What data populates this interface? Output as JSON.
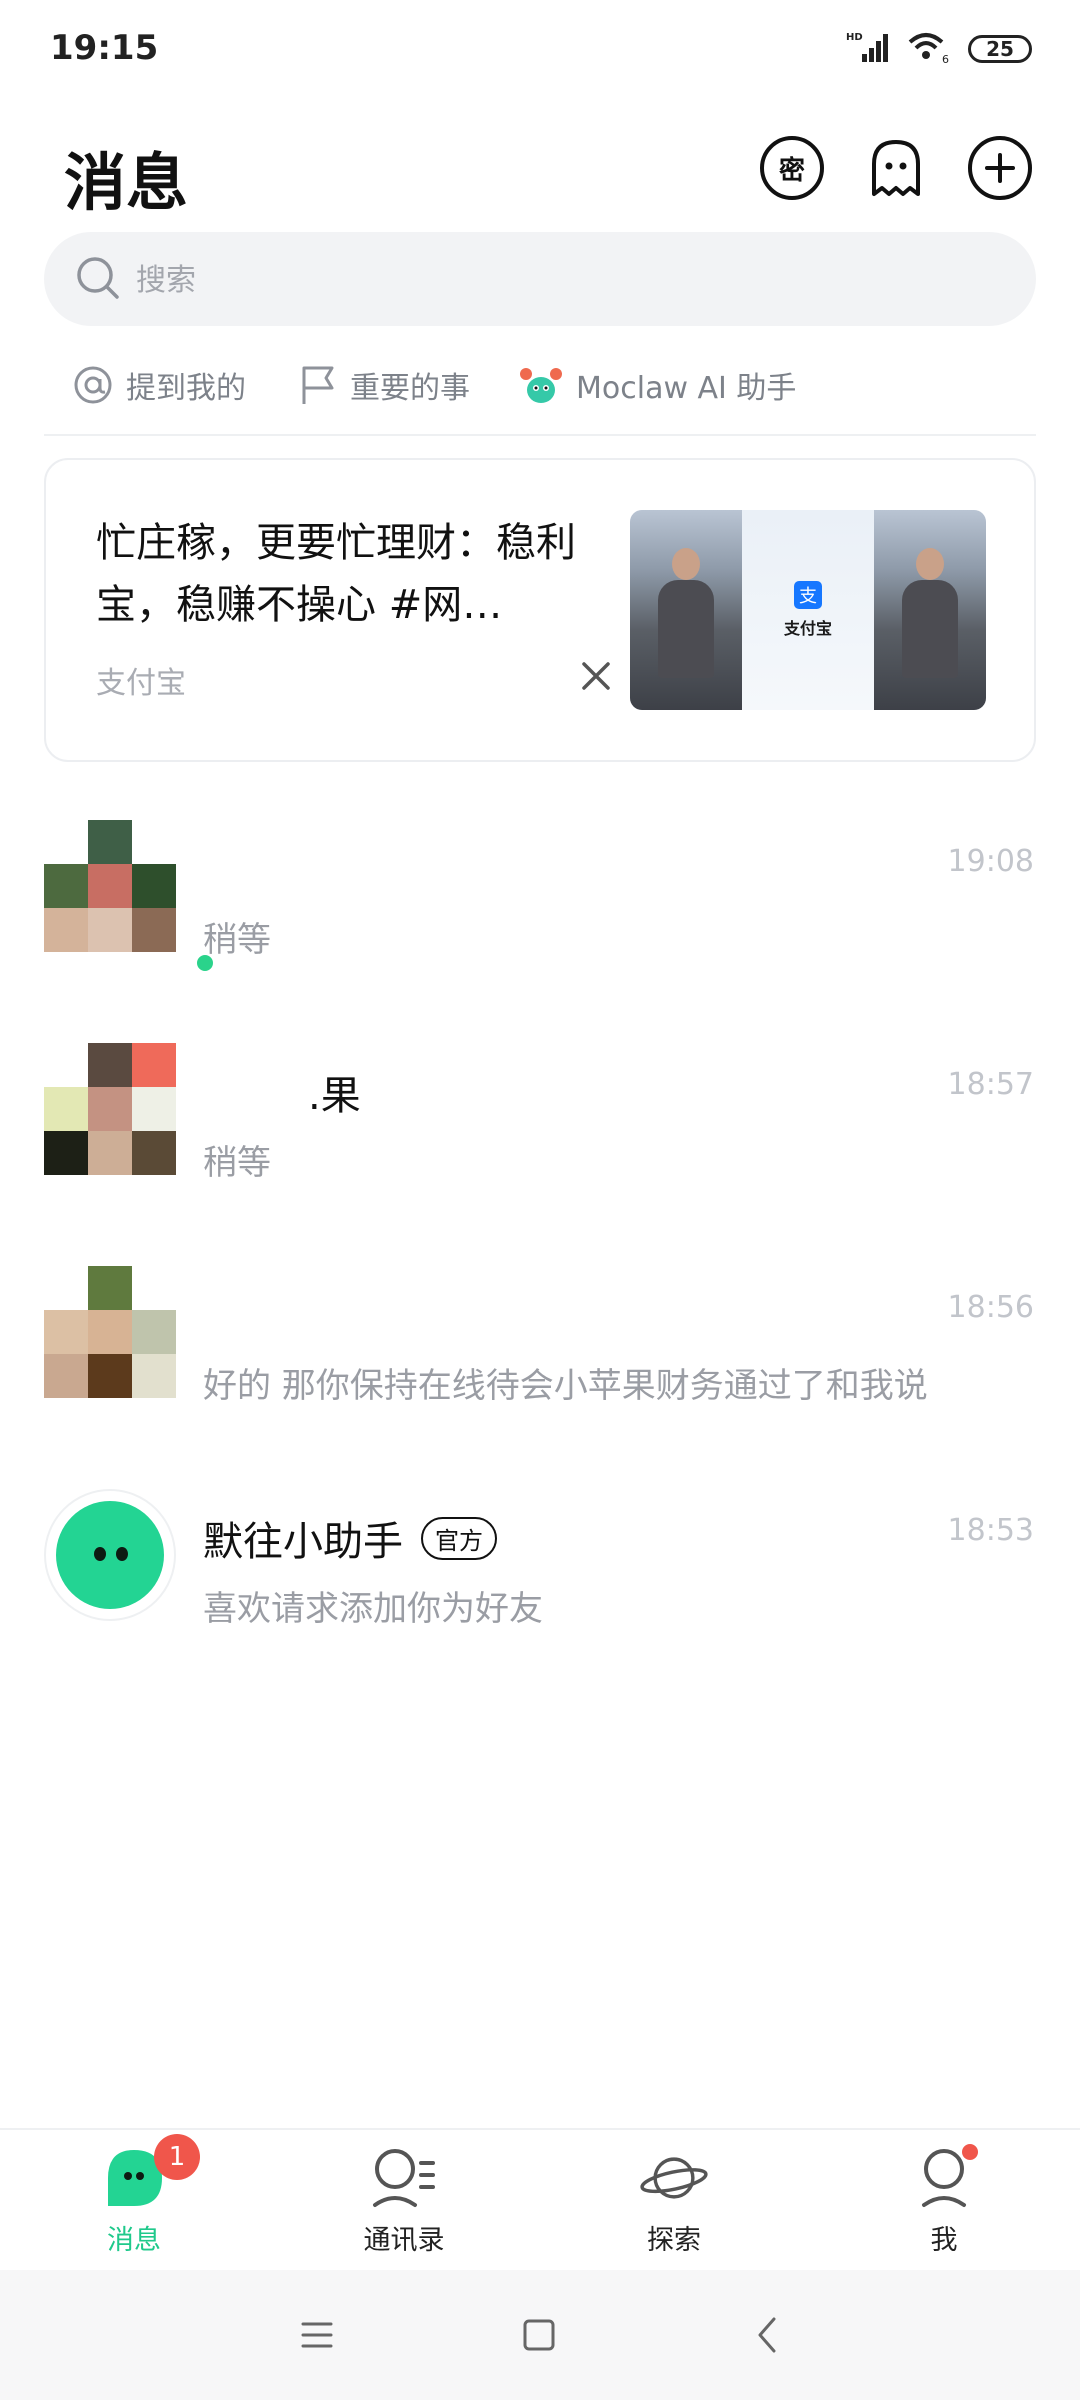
{
  "status_bar": {
    "time": "19:15",
    "battery": "25",
    "network": "HD",
    "wifi_sub": "6"
  },
  "header": {
    "title": "消息",
    "secret_label": "密"
  },
  "search": {
    "placeholder": "搜索"
  },
  "quick_filters": [
    {
      "label": "提到我的",
      "icon": "at-icon"
    },
    {
      "label": "重要的事",
      "icon": "flag-icon"
    },
    {
      "label": "Moclaw AI 助手",
      "icon": "crab-mascot-icon"
    }
  ],
  "ad": {
    "title": "忙庄稼，更要忙理财：稳利宝，稳赚不操心 #网…",
    "source": "支付宝",
    "image_brand": "支付宝",
    "image_brand_logo": "支"
  },
  "chats": [
    {
      "name": "",
      "time": "19:08",
      "preview": "稍等",
      "online": true
    },
    {
      "name": ".果",
      "time": "18:57",
      "preview": "稍等",
      "online": false
    },
    {
      "name": "",
      "time": "18:56",
      "preview": "好的 那你保持在线待会小苹果财务通过了和我说",
      "online": false
    },
    {
      "name": "默往小助手",
      "badge": "官方",
      "time": "18:53",
      "preview": "喜欢请求添加你为好友",
      "online": false
    }
  ],
  "bottom_nav": [
    {
      "label": "消息",
      "active": true,
      "badge": "1"
    },
    {
      "label": "通讯录",
      "active": false
    },
    {
      "label": "探索",
      "active": false
    },
    {
      "label": "我",
      "active": false,
      "dot": true
    }
  ],
  "colors": {
    "accent": "#1fc98b",
    "badge_red": "#f0564b",
    "muted": "#9a9da4"
  }
}
